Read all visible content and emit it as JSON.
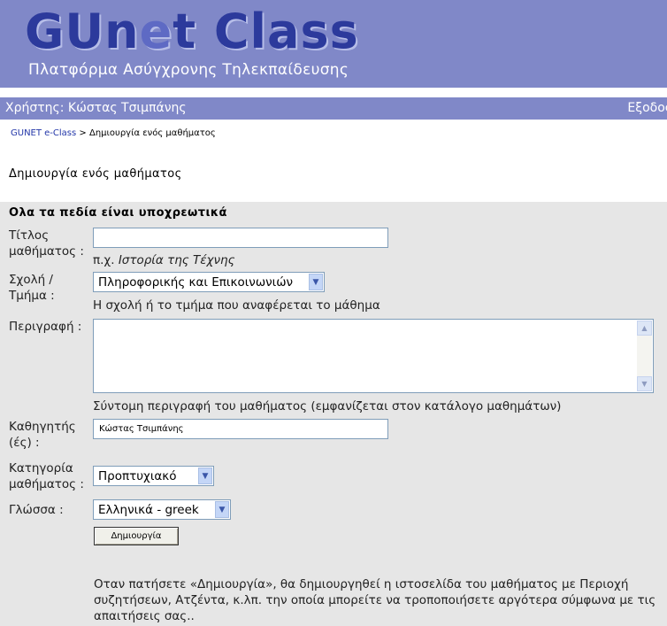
{
  "banner": {
    "logo_prefix": "GUn",
    "logo_highlight": "e",
    "logo_suffix": "t Class",
    "tagline": "Πλατφόρμα Ασύγχρονης Τηλεκπαίδευσης"
  },
  "userbar": {
    "user": "Χρήστης: Κώστας Τσιμπάνης",
    "logout": "Εξοδος"
  },
  "breadcrumb": {
    "home": "GUNET e-Class",
    "separator": " > ",
    "current": "Δημιουργία ενός μαθήματος"
  },
  "page_title": "Δημιουργία ενός μαθήματος",
  "form": {
    "header": "Ολα τα πεδία είναι υποχρεωτικά",
    "title": {
      "label_line1": "Τίτλος",
      "label_line2": "μαθήματος :",
      "value": "",
      "hint_prefix": "π.χ. ",
      "hint_example": "Ιστορία της Τέχνης"
    },
    "faculty": {
      "label_line1": "Σχολή /",
      "label_line2": "Τμήμα :",
      "selected": "Πληροφορικής και Επικοινωνιών",
      "hint": "Η σχολή ή το τμήμα που αναφέρεται το μάθημα"
    },
    "description": {
      "label": "Περιγραφή :",
      "value": "",
      "hint": "Σύντομη περιγραφή του μαθήματος (εμφανίζεται στον κατάλογο μαθημάτων)"
    },
    "professor": {
      "label_line1": "Καθηγητής",
      "label_line2": "(ές) :",
      "value": "Κώστας Τσιμπάνης"
    },
    "category": {
      "label_line1": "Κατηγορία",
      "label_line2": "μαθήματος :",
      "selected": "Προπτυχιακό"
    },
    "language": {
      "label": "Γλώσσα :",
      "selected": "Ελληνικά - greek"
    },
    "submit_label": "Δημιουργία",
    "note": "Οταν πατήσετε «Δημιουργία», θα δημιουργηθεί η ιστοσελίδα του μαθήματος με Περιοχή συζητήσεων, Ατζέντα, κ.λπ. την οποία μπορείτε να τροποποιήσετε αργότερα σύμφωνα με τις απαιτήσεις σας.."
  },
  "colors": {
    "banner_bg": "#8088c8",
    "logo": "#2c3a9c",
    "form_bg": "#e6e6e6",
    "link": "#2236a8"
  }
}
